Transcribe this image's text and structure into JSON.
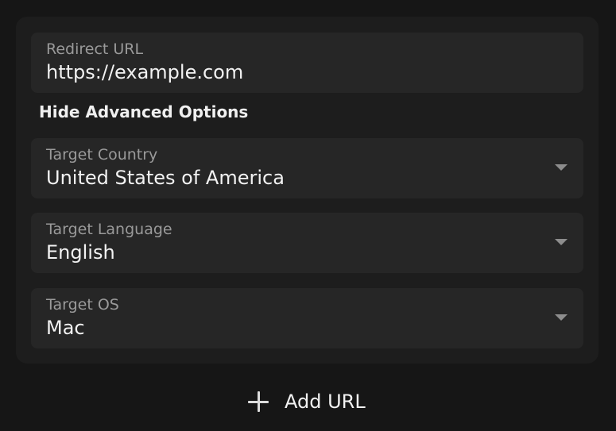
{
  "redirect": {
    "label": "Redirect URL",
    "value": "https://example.com"
  },
  "advanced_toggle_label": "Hide Advanced Options",
  "target_country": {
    "label": "Target Country",
    "value": "United States of America"
  },
  "target_language": {
    "label": "Target Language",
    "value": "English"
  },
  "target_os": {
    "label": "Target OS",
    "value": "Mac"
  },
  "add_url": {
    "label": "Add URL",
    "icon": "plus-icon"
  },
  "colors": {
    "page_background": "#161616",
    "card_background": "#1d1d1d",
    "field_background": "#262626",
    "label_text": "#9a9a9a",
    "value_text": "#f2f2f2"
  }
}
